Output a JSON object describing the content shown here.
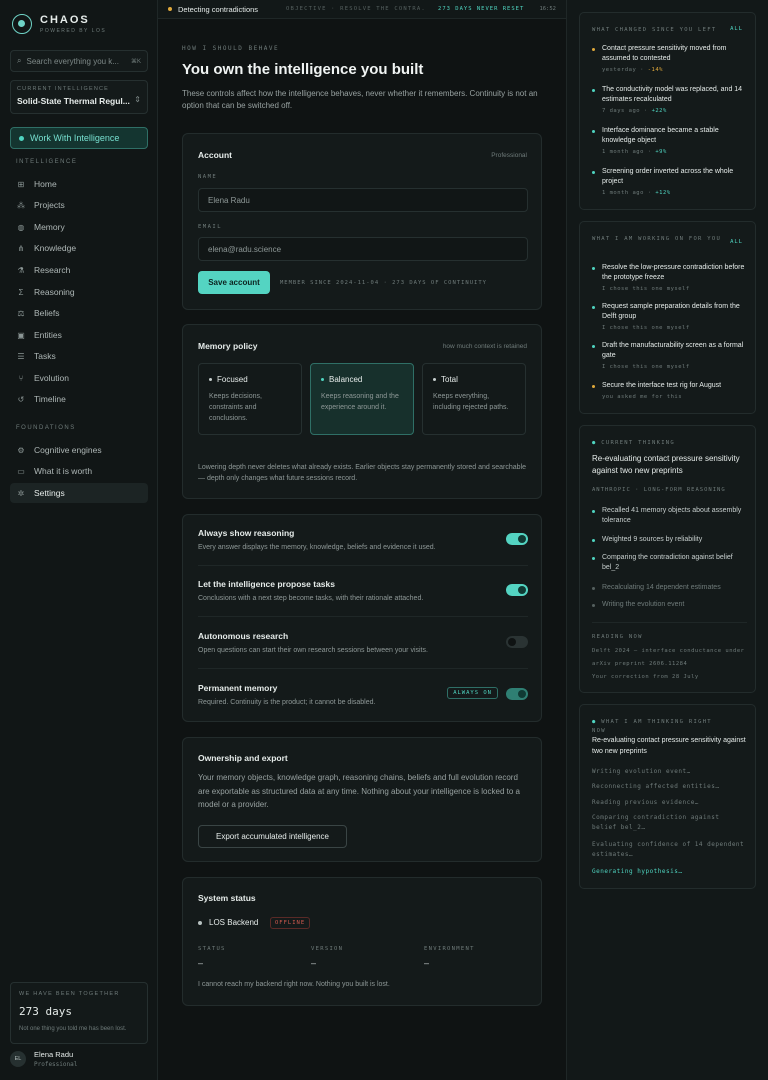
{
  "brand": {
    "name": "CHAOS",
    "sub": "POWERED BY LOS"
  },
  "search": {
    "placeholder": "Search everything you k...",
    "shortcut": "⌘K"
  },
  "current_intelligence": {
    "label": "CURRENT INTELLIGENCE",
    "value": "Solid-State Thermal Regul..."
  },
  "work_button": "Work With Intelligence",
  "sidebar": {
    "intelligence_label": "INTELLIGENCE",
    "items": [
      {
        "label": "Home",
        "icon": "grid-icon"
      },
      {
        "label": "Projects",
        "icon": "network-icon"
      },
      {
        "label": "Memory",
        "icon": "brain-icon"
      },
      {
        "label": "Knowledge",
        "icon": "graph-icon"
      },
      {
        "label": "Research",
        "icon": "flask-icon"
      },
      {
        "label": "Reasoning",
        "icon": "sigma-icon"
      },
      {
        "label": "Beliefs",
        "icon": "scale-icon"
      },
      {
        "label": "Entities",
        "icon": "cube-icon"
      },
      {
        "label": "Tasks",
        "icon": "checklist-icon"
      },
      {
        "label": "Evolution",
        "icon": "branch-icon"
      },
      {
        "label": "Timeline",
        "icon": "history-icon"
      }
    ],
    "foundations_label": "FOUNDATIONS",
    "foundations": [
      {
        "label": "Cognitive engines",
        "icon": "engine-icon"
      },
      {
        "label": "What it is worth",
        "icon": "wallet-icon"
      },
      {
        "label": "Settings",
        "icon": "gear-icon"
      }
    ]
  },
  "together": {
    "label": "WE HAVE BEEN TOGETHER",
    "days": "273 days",
    "note": "Not one thing you told me has been lost."
  },
  "user": {
    "initials": "EL",
    "name": "Elena Radu",
    "role": "Professional"
  },
  "topbar": {
    "status": "Detecting contradictions",
    "objective": "OBJECTIVE · RESOLVE THE CONTRA...",
    "days": "273 DAYS NEVER RESET",
    "time": "16:52"
  },
  "page": {
    "eyebrow": "HOW I SHOULD BEHAVE",
    "title": "You own the intelligence you built",
    "lead": "These controls affect how the intelligence behaves, never whether it remembers. Continuity is not an option that can be switched off."
  },
  "account": {
    "title": "Account",
    "plan": "Professional",
    "name_label": "NAME",
    "name_value": "Elena Radu",
    "email_label": "EMAIL",
    "email_value": "elena@radu.science",
    "save": "Save account",
    "member": "MEMBER SINCE 2024-11-04 · 273 DAYS OF CONTINUITY"
  },
  "memory_policy": {
    "title": "Memory policy",
    "note": "how much context is retained",
    "options": [
      {
        "label": "Focused",
        "desc": "Keeps decisions, constraints and conclusions."
      },
      {
        "label": "Balanced",
        "desc": "Keeps reasoning and the experience around it."
      },
      {
        "label": "Total",
        "desc": "Keeps everything, including rejected paths."
      }
    ],
    "selected": "Balanced",
    "footer": "Lowering depth never deletes what already exists. Earlier objects stay permanently stored and searchable — depth only changes what future sessions record."
  },
  "toggles": [
    {
      "title": "Always show reasoning",
      "desc": "Every answer displays the memory, knowledge, beliefs and evidence it used.",
      "on": true
    },
    {
      "title": "Let the intelligence propose tasks",
      "desc": "Conclusions with a next step become tasks, with their rationale attached.",
      "on": true
    },
    {
      "title": "Autonomous research",
      "desc": "Open questions can start their own research sessions between your visits.",
      "on": false
    },
    {
      "title": "Permanent memory",
      "desc": "Required. Continuity is the product; it cannot be disabled.",
      "on": true,
      "badge": "ALWAYS ON"
    }
  ],
  "ownership": {
    "title": "Ownership and export",
    "text": "Your memory objects, knowledge graph, reasoning chains, beliefs and full evolution record are exportable as structured data at any time. Nothing about your intelligence is locked to a model or a provider.",
    "button": "Export accumulated intelligence"
  },
  "system": {
    "title": "System status",
    "backend": "LOS Backend",
    "badge": "OFFLINE",
    "cols": [
      {
        "k": "STATUS",
        "v": "–"
      },
      {
        "k": "VERSION",
        "v": "–"
      },
      {
        "k": "ENVIRONMENT",
        "v": "–"
      }
    ],
    "footer": "I cannot reach my backend right now. Nothing you built is lost."
  },
  "changed": {
    "title": "WHAT CHANGED SINCE YOU LEFT",
    "all": "ALL",
    "items": [
      {
        "text": "Contact pressure sensitivity moved from assumed to contested",
        "when": "yesterday",
        "delta": "-14%",
        "color": "#e0a93b"
      },
      {
        "text": "The conductivity model was replaced, and 14 estimates recalculated",
        "when": "7 days ago",
        "delta": "+22%",
        "color": "#4fd4c0"
      },
      {
        "text": "Interface dominance became a stable knowledge object",
        "when": "1 month ago",
        "delta": "+9%",
        "color": "#4fd4c0"
      },
      {
        "text": "Screening order inverted across the whole project",
        "when": "1 month ago",
        "delta": "+12%",
        "color": "#4fd4c0"
      }
    ]
  },
  "working": {
    "title": "WHAT I AM WORKING ON FOR YOU",
    "all": "ALL",
    "items": [
      {
        "text": "Resolve the low-pressure contradiction before the prototype freeze",
        "who": "I chose this one myself",
        "color": "#4fd4c0"
      },
      {
        "text": "Request sample preparation details from the Delft group",
        "who": "I chose this one myself",
        "color": "#4fd4c0"
      },
      {
        "text": "Draft the manufacturability screen as a formal gate",
        "who": "I chose this one myself",
        "color": "#4fd4c0"
      },
      {
        "text": "Secure the interface test rig for August",
        "who": "you asked me for this",
        "color": "#e0a93b"
      }
    ]
  },
  "thinking": {
    "label": "CURRENT THINKING",
    "title": "Re-evaluating contact pressure sensitivity against two new preprints",
    "sub": "ANTHROPIC · LONG-FORM REASONING",
    "steps": [
      {
        "text": "Recalled 41 memory objects about assembly tolerance",
        "done": true
      },
      {
        "text": "Weighted 9 sources by reliability",
        "done": true
      },
      {
        "text": "Comparing the contradiction against belief bel_2",
        "done": true
      },
      {
        "text": "Recalculating 14 dependent estimates",
        "done": false
      },
      {
        "text": "Writing the evolution event",
        "done": false
      }
    ],
    "reading_label": "READING NOW",
    "reading": [
      "Delft 2024 — interface conductance under ...",
      "arXiv preprint 2606.11284",
      "Your correction from 28 July"
    ]
  },
  "right_now": {
    "label": "WHAT I AM THINKING RIGHT NOW",
    "title": "Re-evaluating contact pressure sensitivity against two new preprints",
    "lines": [
      "Writing evolution event…",
      "Reconnecting affected entities…",
      "Reading previous evidence…",
      "Comparing contradiction against belief bel_2…",
      "Evaluating confidence of 14 dependent estimates…"
    ],
    "active": "Generating hypothesis…"
  }
}
